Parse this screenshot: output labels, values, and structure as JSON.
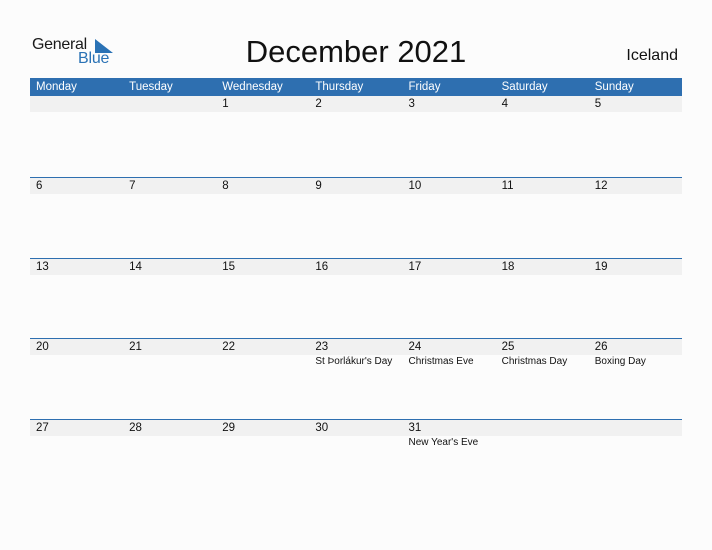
{
  "logo": {
    "general": "General",
    "blue": "Blue",
    "icon": "triangle-flag-icon"
  },
  "title": "December 2021",
  "country": "Iceland",
  "colors": {
    "accent": "#2e6fb0",
    "band": "#f1f1f1"
  },
  "weekdays": [
    "Monday",
    "Tuesday",
    "Wednesday",
    "Thursday",
    "Friday",
    "Saturday",
    "Sunday"
  ],
  "weeks": [
    [
      {
        "day": "",
        "holiday": ""
      },
      {
        "day": "",
        "holiday": ""
      },
      {
        "day": "1",
        "holiday": ""
      },
      {
        "day": "2",
        "holiday": ""
      },
      {
        "day": "3",
        "holiday": ""
      },
      {
        "day": "4",
        "holiday": ""
      },
      {
        "day": "5",
        "holiday": ""
      }
    ],
    [
      {
        "day": "6",
        "holiday": ""
      },
      {
        "day": "7",
        "holiday": ""
      },
      {
        "day": "8",
        "holiday": ""
      },
      {
        "day": "9",
        "holiday": ""
      },
      {
        "day": "10",
        "holiday": ""
      },
      {
        "day": "11",
        "holiday": ""
      },
      {
        "day": "12",
        "holiday": ""
      }
    ],
    [
      {
        "day": "13",
        "holiday": ""
      },
      {
        "day": "14",
        "holiday": ""
      },
      {
        "day": "15",
        "holiday": ""
      },
      {
        "day": "16",
        "holiday": ""
      },
      {
        "day": "17",
        "holiday": ""
      },
      {
        "day": "18",
        "holiday": ""
      },
      {
        "day": "19",
        "holiday": ""
      }
    ],
    [
      {
        "day": "20",
        "holiday": ""
      },
      {
        "day": "21",
        "holiday": ""
      },
      {
        "day": "22",
        "holiday": ""
      },
      {
        "day": "23",
        "holiday": "St Þorlákur's Day"
      },
      {
        "day": "24",
        "holiday": "Christmas Eve"
      },
      {
        "day": "25",
        "holiday": "Christmas Day"
      },
      {
        "day": "26",
        "holiday": "Boxing Day"
      }
    ],
    [
      {
        "day": "27",
        "holiday": ""
      },
      {
        "day": "28",
        "holiday": ""
      },
      {
        "day": "29",
        "holiday": ""
      },
      {
        "day": "30",
        "holiday": ""
      },
      {
        "day": "31",
        "holiday": "New Year's Eve"
      },
      {
        "day": "",
        "holiday": ""
      },
      {
        "day": "",
        "holiday": ""
      }
    ]
  ]
}
